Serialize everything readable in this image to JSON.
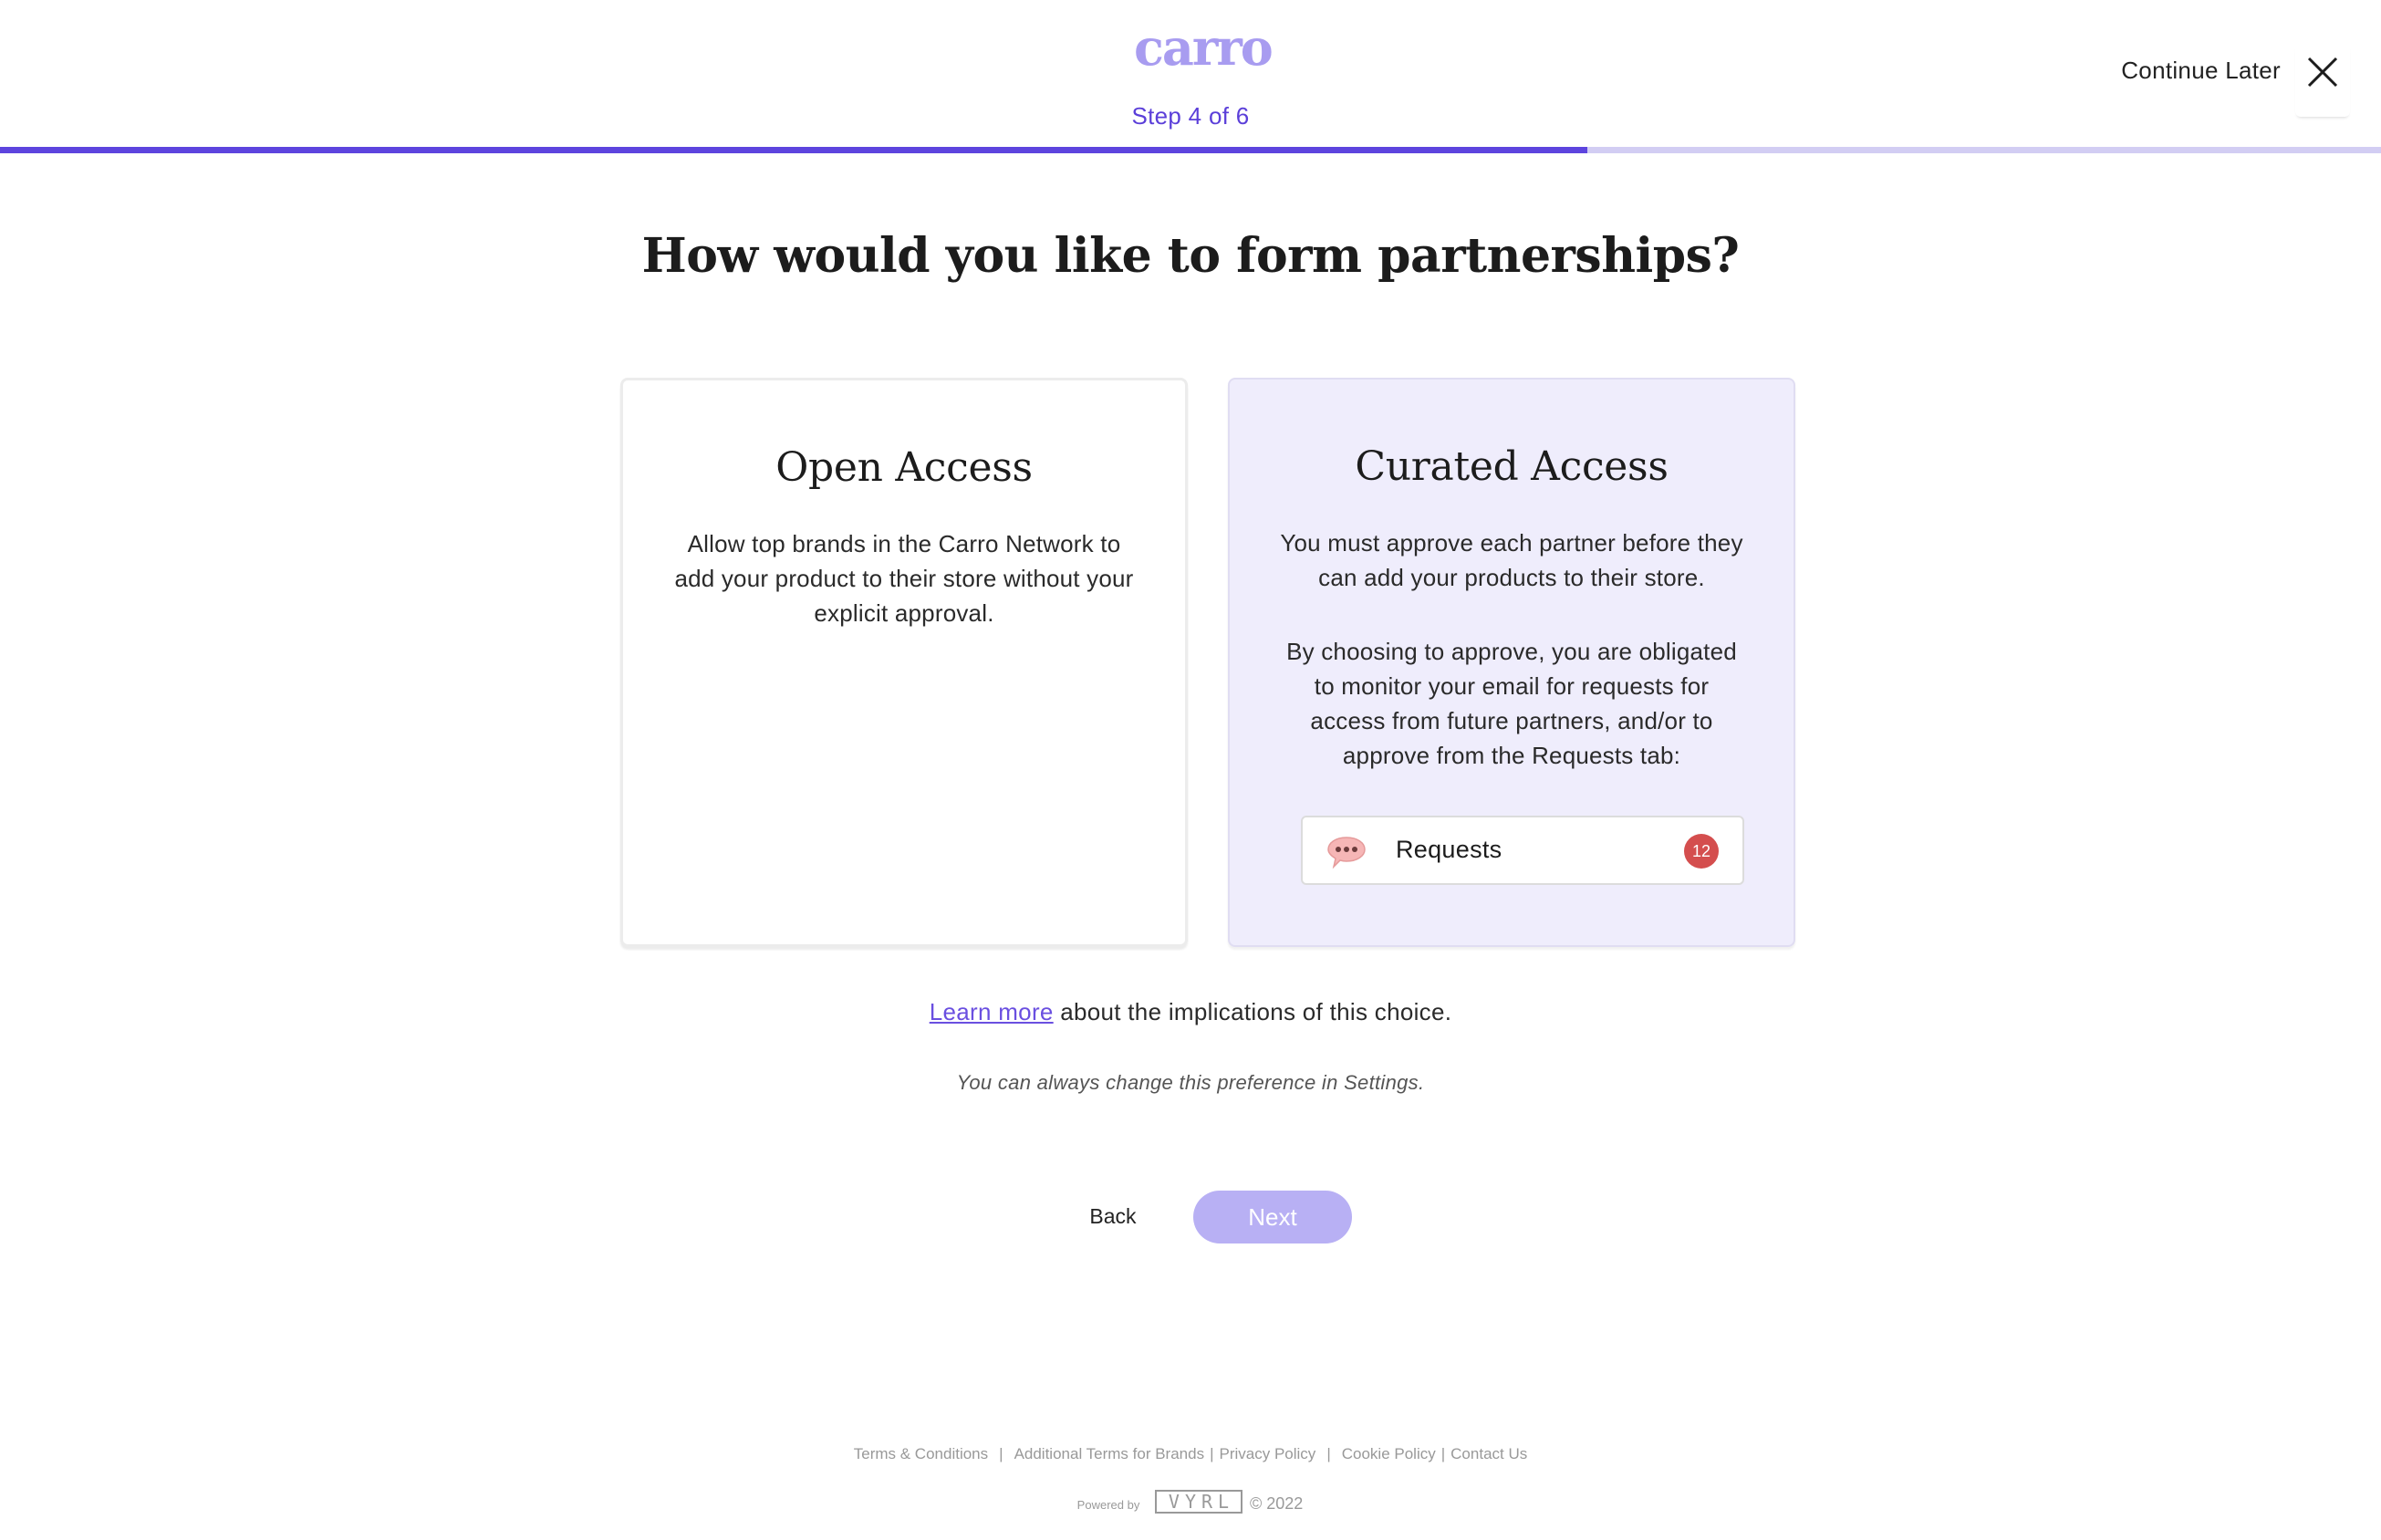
{
  "header": {
    "logo_text": "carro",
    "step_label": "Step 4 of 6",
    "progress_fraction": 0.6667,
    "continue_later_label": "Continue Later"
  },
  "main": {
    "title": "How would you like to form partnerships?",
    "open_access": {
      "title": "Open Access",
      "description": "Allow top brands in the Carro Network to add your product to their store without your explicit approval."
    },
    "curated_access": {
      "title": "Curated Access",
      "description_1": "You must approve each partner before they can add your products to their store.",
      "description_2": "By choosing to approve, you are obligated to monitor your email for requests for access from future partners, and/or to approve from the Requests tab:",
      "requests_label": "Requests",
      "requests_count": "12"
    },
    "learn_more_link": "Learn more",
    "learn_more_rest": " about the implications of this choice.",
    "preference_note": "You can always change this preference in Settings.",
    "back_label": "Back",
    "next_label": "Next"
  },
  "footer": {
    "links": [
      "Terms & Conditions",
      "Additional Terms for Brands",
      "Privacy Policy",
      "Cookie Policy",
      "Contact Us"
    ],
    "powered_by": "Powered by",
    "vyrl_logo": "VYRL",
    "copyright": "© 2022"
  },
  "colors": {
    "accent": "#5d44de",
    "progress_track": "#d2cdf3",
    "curated_bg": "#efedfc",
    "badge": "#d44e4e",
    "next_button": "#b8b0f4"
  }
}
